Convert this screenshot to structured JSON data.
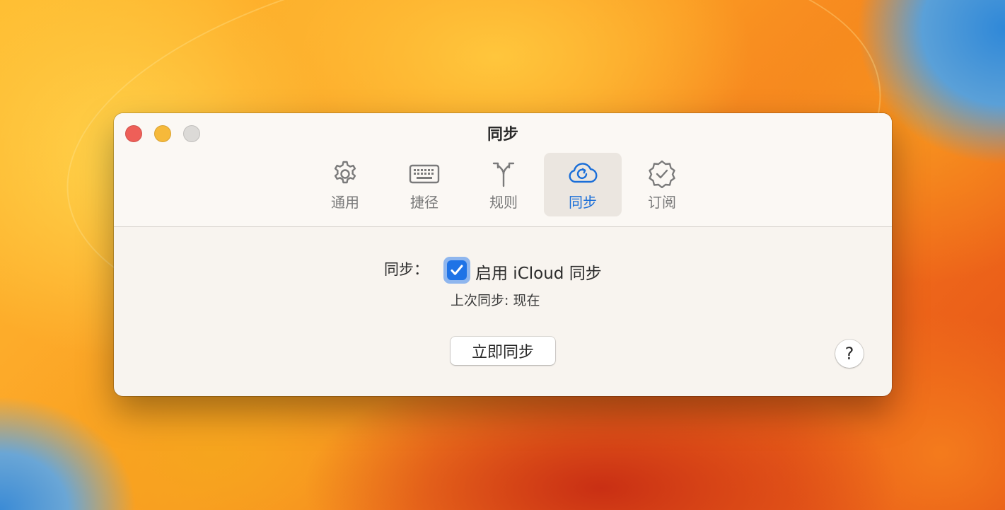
{
  "window": {
    "title": "同步"
  },
  "tabs": [
    {
      "label": "通用",
      "icon": "gear-icon",
      "active": false
    },
    {
      "label": "捷径",
      "icon": "keyboard-icon",
      "active": false
    },
    {
      "label": "规则",
      "icon": "fork-arrow-icon",
      "active": false
    },
    {
      "label": "同步",
      "icon": "cloud-sync-icon",
      "active": true
    },
    {
      "label": "订阅",
      "icon": "verified-badge-icon",
      "active": false
    }
  ],
  "sync": {
    "row_label": "同步：",
    "checkbox_label": "启用 iCloud 同步",
    "checkbox_checked": true,
    "last_sync": "上次同步: 现在",
    "sync_now_button": "立即同步",
    "help_button": "?"
  },
  "colors": {
    "accent": "#1f73e6",
    "close": "#ee5f58",
    "minimize": "#f6b93a",
    "zoom": "#dcdad7"
  }
}
